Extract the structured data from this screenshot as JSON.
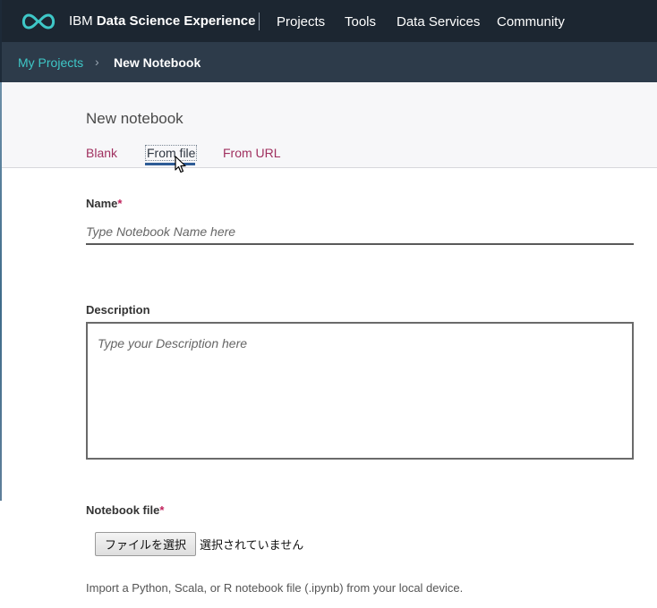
{
  "topnav": {
    "brand_prefix": "IBM",
    "brand_name": "Data Science Experience",
    "items": [
      {
        "label": "Projects"
      },
      {
        "label": "Tools"
      },
      {
        "label": "Data Services"
      },
      {
        "label": "Community"
      }
    ]
  },
  "breadcrumb": {
    "parent": "My Projects",
    "separator": "›",
    "current": "New Notebook"
  },
  "page": {
    "title": "New notebook",
    "tabs": [
      {
        "label": "Blank",
        "active": false
      },
      {
        "label": "From file",
        "active": true
      },
      {
        "label": "From URL",
        "active": false
      }
    ]
  },
  "form": {
    "name_label": "Name",
    "required_marker": "*",
    "name_placeholder": "Type Notebook Name here",
    "name_value": "",
    "description_label": "Description",
    "description_placeholder": "Type your Description here",
    "description_value": "",
    "file_label": "Notebook file",
    "file_button_label": "ファイルを選択",
    "file_status": "選択されていません",
    "file_help": "Import a Python, Scala, or R notebook file (.ipynb) from your local device."
  },
  "colors": {
    "topnav_bg": "#1c2631",
    "breadcrumb_bg": "#2d3b4a",
    "accent_teal": "#3ec7c7",
    "tab_link": "#a0305f",
    "tab_underline": "#2d5b96",
    "required": "#c0215b"
  },
  "icons": {
    "logo": "infinity-logo-icon",
    "cursor": "mouse-pointer-icon"
  }
}
